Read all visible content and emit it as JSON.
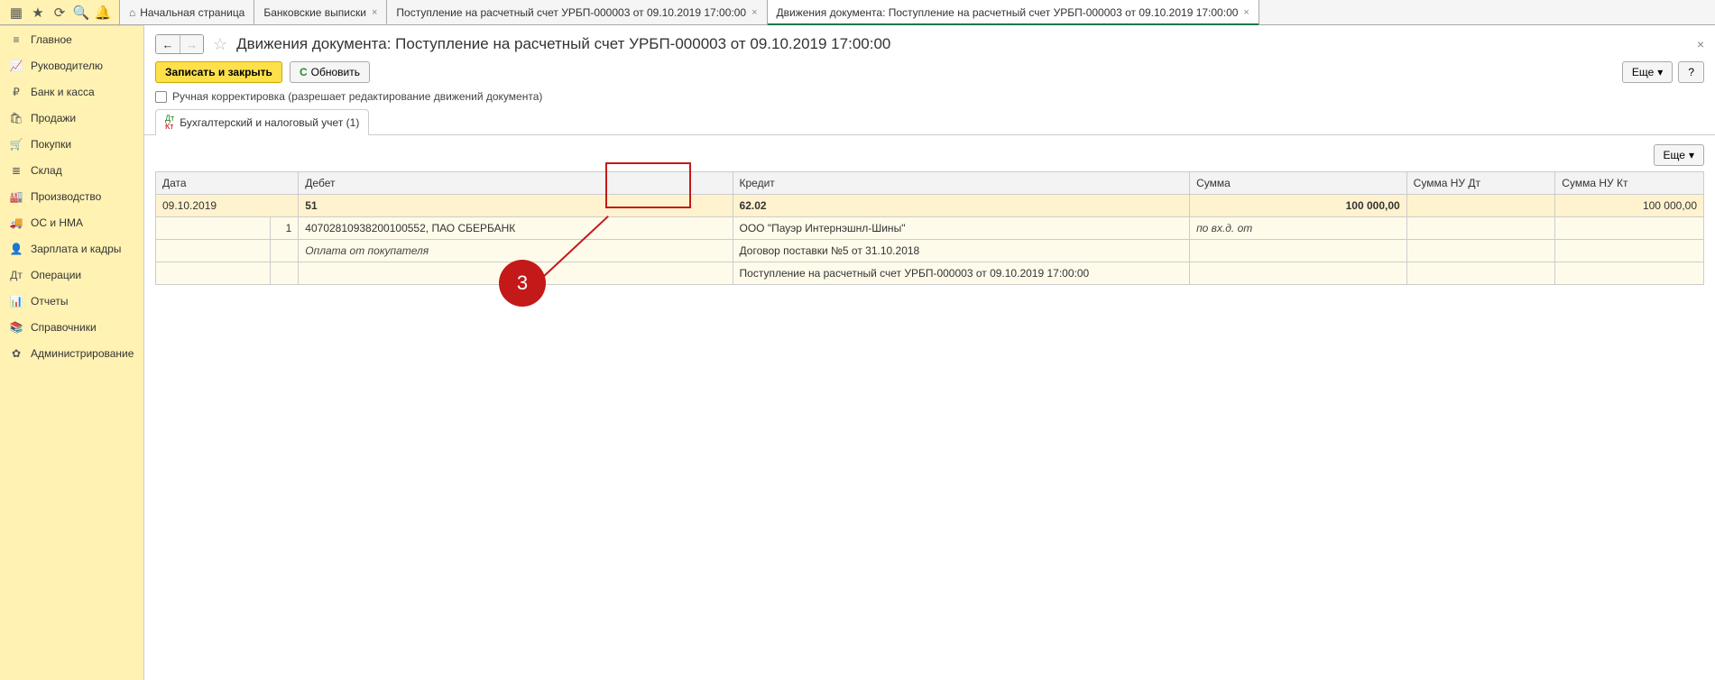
{
  "top_icons": [
    "apps-icon",
    "star-icon",
    "history-icon",
    "search-icon",
    "bell-icon"
  ],
  "top_icon_glyphs": [
    "▦",
    "★",
    "⟳",
    "🔍",
    "🔔"
  ],
  "tabs": [
    {
      "label": "Начальная страница",
      "home": true,
      "closable": false
    },
    {
      "label": "Банковские выписки",
      "closable": true
    },
    {
      "label": "Поступление на расчетный счет УРБП-000003 от 09.10.2019 17:00:00",
      "closable": true
    },
    {
      "label": "Движения документа: Поступление на расчетный счет УРБП-000003 от 09.10.2019 17:00:00",
      "closable": true,
      "active": true
    }
  ],
  "sidebar": [
    {
      "icon": "≡",
      "name": "menu-icon",
      "label": "Главное"
    },
    {
      "icon": "📈",
      "name": "chart-up-icon",
      "label": "Руководителю"
    },
    {
      "icon": "₽",
      "name": "ruble-icon",
      "label": "Банк и касса"
    },
    {
      "icon": "🛍",
      "name": "bag-icon",
      "label": "Продажи"
    },
    {
      "icon": "🛒",
      "name": "cart-icon",
      "label": "Покупки"
    },
    {
      "icon": "≣",
      "name": "shelf-icon",
      "label": "Склад"
    },
    {
      "icon": "🏭",
      "name": "factory-icon",
      "label": "Производство"
    },
    {
      "icon": "🚚",
      "name": "truck-icon",
      "label": "ОС и НМА"
    },
    {
      "icon": "👤",
      "name": "person-icon",
      "label": "Зарплата и кадры"
    },
    {
      "icon": "Дт",
      "name": "dtkt-icon",
      "label": "Операции"
    },
    {
      "icon": "📊",
      "name": "barchart-icon",
      "label": "Отчеты"
    },
    {
      "icon": "📚",
      "name": "books-icon",
      "label": "Справочники"
    },
    {
      "icon": "✿",
      "name": "gear-icon",
      "label": "Администрирование"
    }
  ],
  "header": {
    "title": "Движения документа: Поступление на расчетный счет УРБП-000003 от 09.10.2019 17:00:00"
  },
  "toolbar": {
    "save_close": "Записать и закрыть",
    "refresh": "Обновить",
    "more": "Еще",
    "help": "?"
  },
  "checkbox_label": "Ручная корректировка (разрешает редактирование движений документа)",
  "subtab": "Бухгалтерский и налоговый учет (1)",
  "grid": {
    "more": "Еще",
    "cols": {
      "date": "Дата",
      "debet": "Дебет",
      "kredit": "Кредит",
      "sum": "Сумма",
      "nudt": "Сумма НУ Дт",
      "nukt": "Сумма НУ Кт"
    },
    "row_acc": {
      "date": "09.10.2019",
      "debet": "51",
      "kredit": "62.02",
      "sum": "100 000,00",
      "nukt": "100 000,00"
    },
    "row_det": {
      "num": "1",
      "debet_sub1": "40702810938200100552, ПАО СБЕРБАНК",
      "kredit_sub1": "ООО \"Пауэр Интернэшнл-Шины\"",
      "sum_note": "по вх.д.  от",
      "debet_sub2": "Оплата от покупателя",
      "kredit_sub2": "Договор поставки №5 от 31.10.2018",
      "kredit_sub3": "Поступление на расчетный счет УРБП-000003 от 09.10.2019 17:00:00"
    }
  },
  "annotation": {
    "number": "3"
  }
}
